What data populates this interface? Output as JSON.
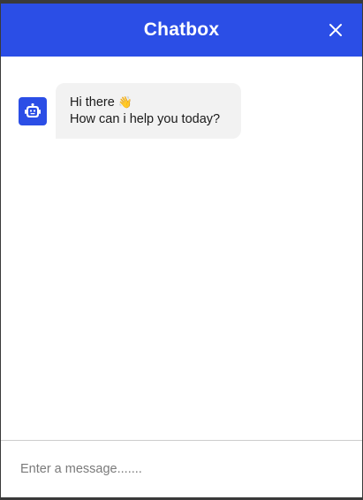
{
  "header": {
    "title": "Chatbox"
  },
  "icons": {
    "close": "close-icon",
    "bot": "robot-icon",
    "wave": "waving-hand-icon"
  },
  "messages": [
    {
      "sender": "bot",
      "line1": "Hi there",
      "emoji": "👋",
      "line2": "How can i help you today?"
    }
  ],
  "input": {
    "placeholder": "Enter a message......."
  },
  "colors": {
    "accent": "#2b4ee6",
    "bubble": "#f2f2f2"
  }
}
